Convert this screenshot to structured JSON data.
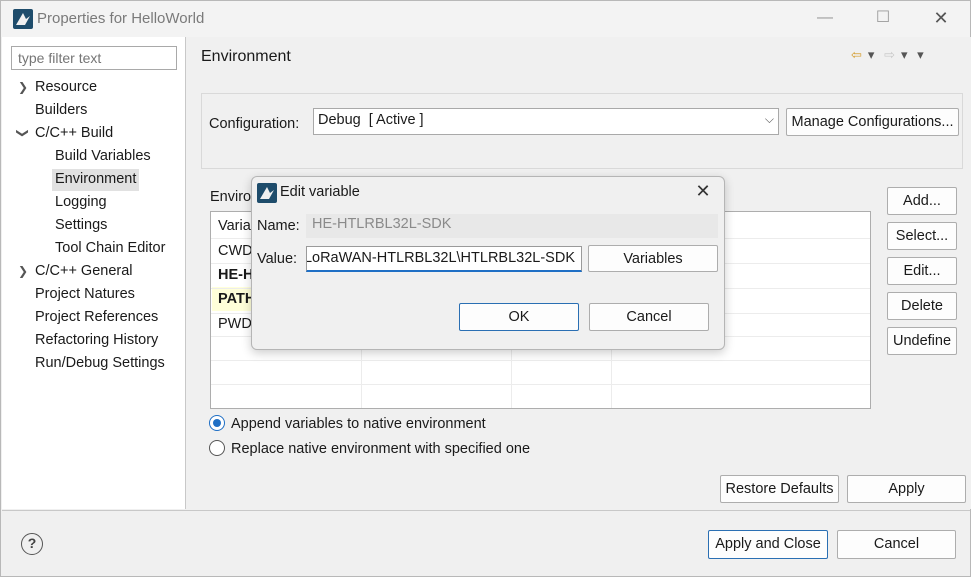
{
  "window": {
    "title": "Properties for HelloWorld",
    "minimize": "—",
    "maximize": "☐",
    "close": "✕"
  },
  "sidebar": {
    "filter_placeholder": "type filter text",
    "items": [
      {
        "label": "Resource"
      },
      {
        "label": "Builders"
      },
      {
        "label": "C/C++ Build"
      },
      {
        "label": "Build Variables"
      },
      {
        "label": "Environment"
      },
      {
        "label": "Logging"
      },
      {
        "label": "Settings"
      },
      {
        "label": "Tool Chain Editor"
      },
      {
        "label": "C/C++ General"
      },
      {
        "label": "Project Natures"
      },
      {
        "label": "Project References"
      },
      {
        "label": "Refactoring History"
      },
      {
        "label": "Run/Debug Settings"
      }
    ]
  },
  "page": {
    "title": "Environment",
    "configuration_label": "Configuration:",
    "configuration_value": "Debug  [ Active ]",
    "manage_button": "Manage Configurations...",
    "env_label": "Enviro",
    "table_rows": [
      {
        "name": "Varia",
        "bold": false,
        "highlight": false
      },
      {
        "name": "CWD",
        "bold": false,
        "highlight": false
      },
      {
        "name": "HE-H",
        "bold": true,
        "highlight": false
      },
      {
        "name": "PATH",
        "bold": true,
        "highlight": true
      },
      {
        "name": "PWD",
        "bold": false,
        "highlight": false
      }
    ],
    "side_buttons": {
      "add": "Add...",
      "select": "Select...",
      "edit": "Edit...",
      "delete": "Delete",
      "undefine": "Undefine"
    },
    "radio_append": "Append variables to native environment",
    "radio_replace": "Replace native environment with specified one",
    "radio_selected": "append",
    "restore_defaults": "Restore Defaults",
    "apply": "Apply"
  },
  "bottom": {
    "help": "?",
    "apply_close": "Apply and Close",
    "cancel": "Cancel"
  },
  "dialog": {
    "title": "Edit variable",
    "close": "✕",
    "name_label": "Name:",
    "name_value": "HE-HTLRBL32L-SDK",
    "value_label": "Value:",
    "value_value": "·LoRaWAN-HTLRBL32L\\HTLRBL32L-SDK",
    "variables_button": "Variables",
    "ok": "OK",
    "cancel": "Cancel"
  },
  "colors": {
    "accent": "#1f6fc5",
    "highlight_row": "#ffffd9",
    "nav_back": "#d39b2a"
  }
}
